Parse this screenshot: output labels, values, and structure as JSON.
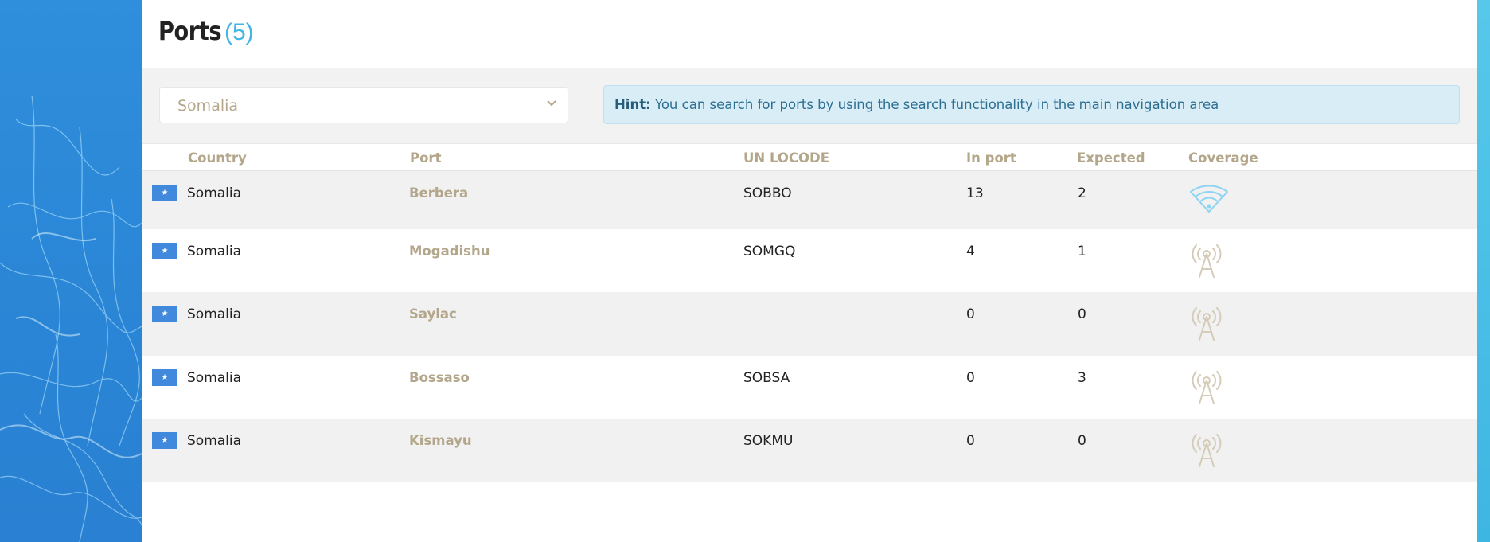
{
  "page": {
    "title": "Ports",
    "count": "(5)"
  },
  "filter": {
    "selected_country": "Somalia",
    "hint_label": "Hint:",
    "hint_text": " You can search for ports by using the search functionality in the main navigation area"
  },
  "table": {
    "headers": {
      "country": "Country",
      "port": "Port",
      "unlocode": "UN LOCODE",
      "in_port": "In port",
      "expected": "Expected",
      "coverage": "Coverage"
    },
    "rows": [
      {
        "country": "Somalia",
        "port": "Berbera",
        "unlocode": "SOBBO",
        "in_port": "13",
        "expected": "2",
        "coverage_icon": "wifi-icon"
      },
      {
        "country": "Somalia",
        "port": "Mogadishu",
        "unlocode": "SOMGQ",
        "in_port": "4",
        "expected": "1",
        "coverage_icon": "antenna-tower-icon"
      },
      {
        "country": "Somalia",
        "port": "Saylac",
        "unlocode": "",
        "in_port": "0",
        "expected": "0",
        "coverage_icon": "antenna-tower-icon"
      },
      {
        "country": "Somalia",
        "port": "Bossaso",
        "unlocode": "SOBSA",
        "in_port": "0",
        "expected": "3",
        "coverage_icon": "antenna-tower-icon"
      },
      {
        "country": "Somalia",
        "port": "Kismayu",
        "unlocode": "SOKMU",
        "in_port": "0",
        "expected": "0",
        "coverage_icon": "antenna-tower-icon"
      }
    ]
  },
  "colors": {
    "accent": "#3fb6e6",
    "link": "#b3a68a",
    "hint_bg": "#d9edf7",
    "flag_blue": "#4189dd",
    "row_alt": "#f0f1f0"
  }
}
